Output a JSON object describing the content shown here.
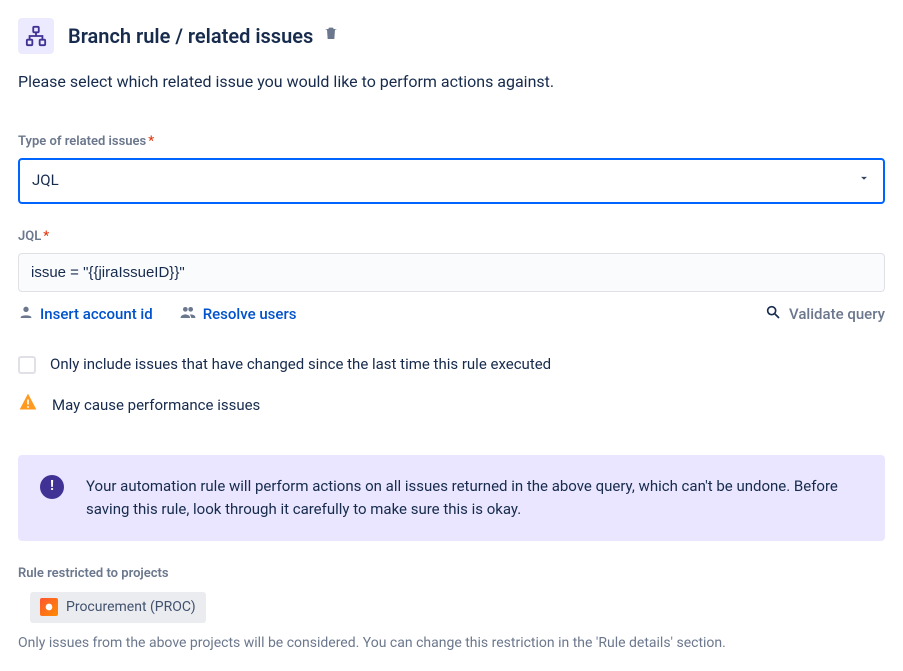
{
  "header": {
    "title": "Branch rule / related issues"
  },
  "description": "Please select which related issue you would like to perform actions against.",
  "type_field": {
    "label": "Type of related issues",
    "value": "JQL"
  },
  "jql_field": {
    "label": "JQL",
    "value": "issue = \"{{jiraIssueID}}\""
  },
  "helpers": {
    "insert_account": "Insert account id",
    "resolve_users": "Resolve users",
    "validate_query": "Validate query"
  },
  "checkbox_label": "Only include issues that have changed since the last time this rule executed",
  "warning_text": "May cause performance issues",
  "info_text": "Your automation rule will perform actions on all issues returned in the above query, which can't be undone. Before saving this rule, look through it carefully to make sure this is okay.",
  "projects": {
    "label": "Rule restricted to projects",
    "chip": "Procurement (PROC)",
    "footnote": "Only issues from the above projects will be considered. You can change this restriction in the 'Rule details' section."
  }
}
